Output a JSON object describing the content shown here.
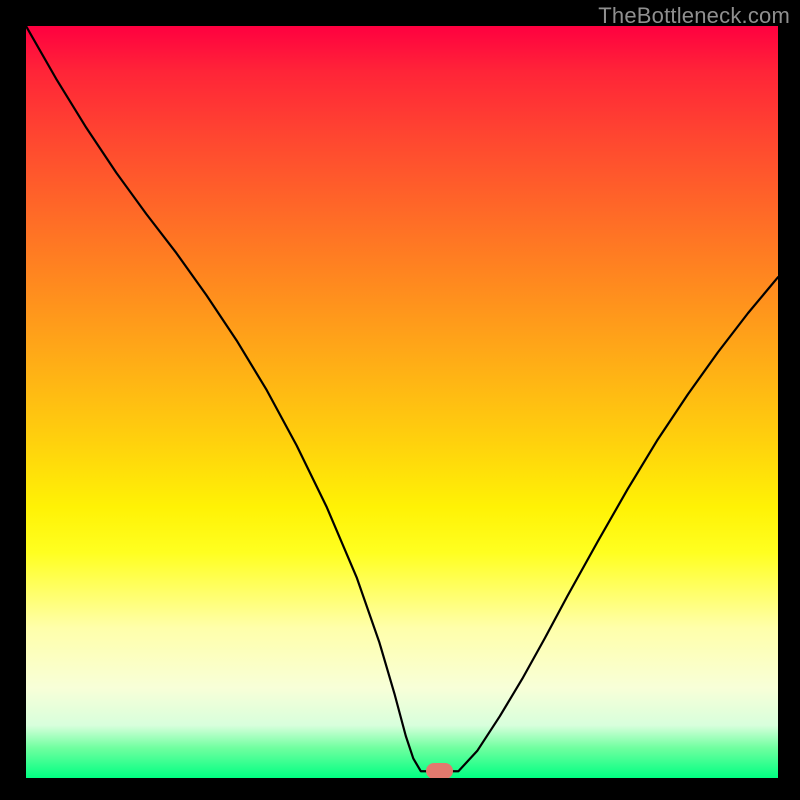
{
  "watermark": "TheBottleneck.com",
  "colors": {
    "frame": "#000000",
    "curve": "#000000",
    "marker": "#e2796e",
    "watermark": "#8f8f8f"
  },
  "chart_data": {
    "type": "line",
    "title": "",
    "xlabel": "",
    "ylabel": "",
    "xlim": [
      0,
      100
    ],
    "ylim": [
      0,
      100
    ],
    "grid": false,
    "series": [
      {
        "name": "curve-left",
        "x": [
          0,
          4,
          8,
          12,
          16,
          20,
          24,
          28,
          32,
          36,
          40,
          44,
          47,
          49,
          50.5,
          51.5,
          52.5
        ],
        "values": [
          100,
          93,
          86.5,
          80.5,
          75,
          69.8,
          64.2,
          58.2,
          51.6,
          44.2,
          36,
          26.6,
          18,
          11.2,
          5.6,
          2.6,
          0.9
        ]
      },
      {
        "name": "curve-floor",
        "x": [
          52.5,
          57.5
        ],
        "values": [
          0.9,
          0.9
        ]
      },
      {
        "name": "curve-right",
        "x": [
          57.5,
          60,
          63,
          66,
          69,
          72,
          76,
          80,
          84,
          88,
          92,
          96,
          100
        ],
        "values": [
          0.9,
          3.6,
          8.2,
          13.2,
          18.6,
          24.2,
          31.4,
          38.4,
          45,
          51,
          56.6,
          61.8,
          66.6
        ]
      }
    ],
    "marker": {
      "x": 55,
      "y": 0.9,
      "width": 3.6,
      "height": 2.2
    },
    "background_gradient": [
      {
        "pos": 0,
        "color": "#ff0040"
      },
      {
        "pos": 15,
        "color": "#ff4730"
      },
      {
        "pos": 35,
        "color": "#ff8c1e"
      },
      {
        "pos": 55,
        "color": "#ffd00d"
      },
      {
        "pos": 70,
        "color": "#ffff20"
      },
      {
        "pos": 88,
        "color": "#f8ffd8"
      },
      {
        "pos": 100,
        "color": "#00ff82"
      }
    ]
  }
}
